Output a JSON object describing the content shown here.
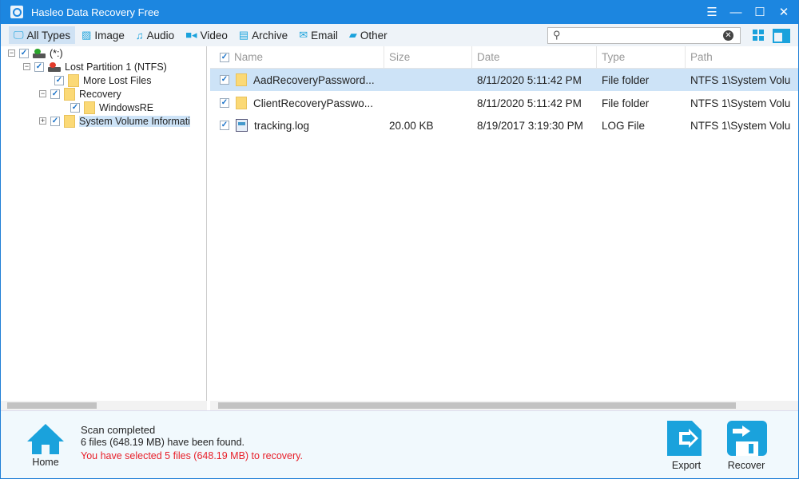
{
  "window": {
    "title": "Hasleo Data Recovery Free",
    "controls": [
      "menu",
      "minimize",
      "maximize",
      "close"
    ]
  },
  "toolbar": {
    "types": [
      {
        "label": "All Types",
        "icon": "monitor-icon",
        "active": true
      },
      {
        "label": "Image",
        "icon": "image-icon"
      },
      {
        "label": "Audio",
        "icon": "music-icon"
      },
      {
        "label": "Video",
        "icon": "video-icon"
      },
      {
        "label": "Archive",
        "icon": "archive-icon"
      },
      {
        "label": "Email",
        "icon": "email-icon"
      },
      {
        "label": "Other",
        "icon": "folder-icon"
      }
    ],
    "search": {
      "value": "",
      "placeholder": ""
    }
  },
  "tree": [
    {
      "label": "(*:)"
    },
    {
      "label": "Lost Partition 1 (NTFS)"
    },
    {
      "label": "More Lost Files"
    },
    {
      "label": "Recovery"
    },
    {
      "label": "WindowsRE"
    },
    {
      "label": "System Volume Informati"
    }
  ],
  "table": {
    "columns": [
      "Name",
      "Size",
      "Date",
      "Type",
      "Path"
    ],
    "rows": [
      {
        "name": "AadRecoveryPassword...",
        "size": "",
        "date": "8/11/2020 5:11:42 PM",
        "type": "File folder",
        "path": "NTFS 1\\System Volu"
      },
      {
        "name": "ClientRecoveryPasswo...",
        "size": "",
        "date": "8/11/2020 5:11:42 PM",
        "type": "File folder",
        "path": "NTFS 1\\System Volu"
      },
      {
        "name": "tracking.log",
        "size": "20.00 KB",
        "date": "8/19/2017 3:19:30 PM",
        "type": "LOG File",
        "path": "NTFS 1\\System Volu"
      }
    ]
  },
  "status": {
    "line1": "Scan completed",
    "line2": "6 files (648.19 MB) have been found.",
    "line3": "You have selected 5 files (648.19 MB) to recovery."
  },
  "buttons": {
    "home": "Home",
    "export": "Export",
    "recover": "Recover"
  },
  "colors": {
    "accent": "#1c86e0",
    "icon": "#1aa2dc",
    "warning": "#e8202a"
  }
}
